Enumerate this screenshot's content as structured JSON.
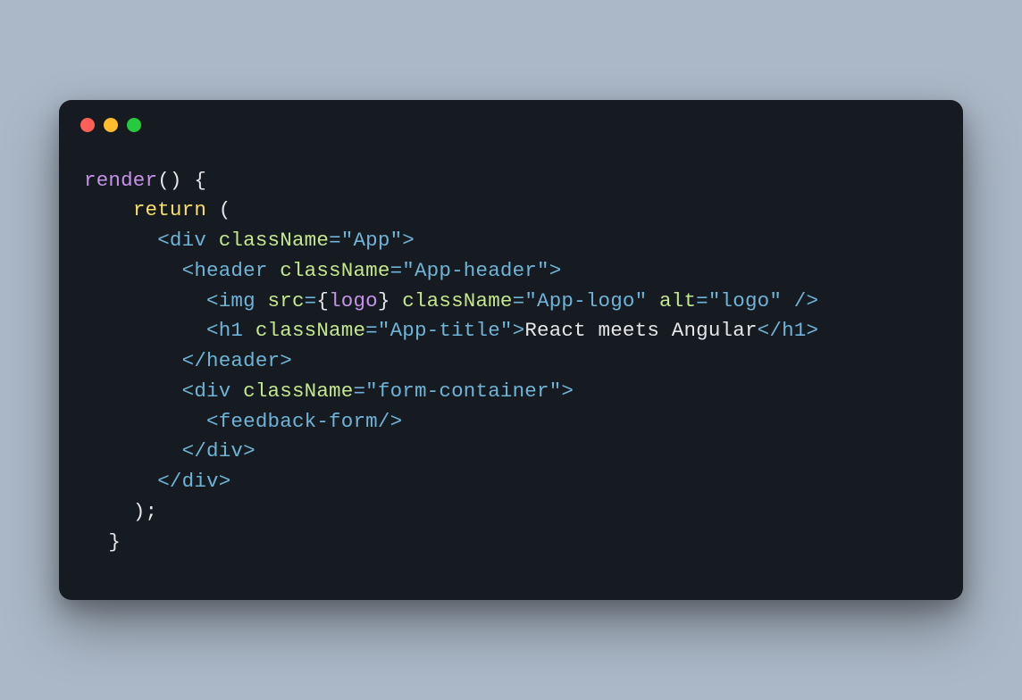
{
  "window": {
    "traffic_lights": [
      "close",
      "minimize",
      "zoom"
    ],
    "colors": {
      "close": "#ff5f56",
      "minimize": "#ffbd2e",
      "zoom": "#27c93f",
      "background": "#161b21",
      "page_background": "#abb8c7"
    }
  },
  "code": {
    "indent": "  ",
    "fn_name": "render",
    "kw_return": "return",
    "tags": {
      "div": "div",
      "header": "header",
      "img": "img",
      "h1": "h1",
      "feedback_form": "feedback-form"
    },
    "attrs": {
      "className": "className",
      "src": "src",
      "alt": "alt"
    },
    "values": {
      "App": "\"App\"",
      "App_header": "\"App-header\"",
      "App_logo": "\"App-logo\"",
      "logo_alt": "\"logo\"",
      "App_title": "\"App-title\"",
      "form_container": "\"form-container\""
    },
    "expr_logo": "logo",
    "text_h1": "React meets Angular",
    "punc": {
      "lparen": "(",
      "rparen": ")",
      "lbrace": "{",
      "rbrace": "}",
      "lt": "<",
      "gt": ">",
      "lt_slash": "</",
      "slash_gt": "/>",
      "eq": "=",
      "semi": ";",
      "space": " "
    }
  }
}
